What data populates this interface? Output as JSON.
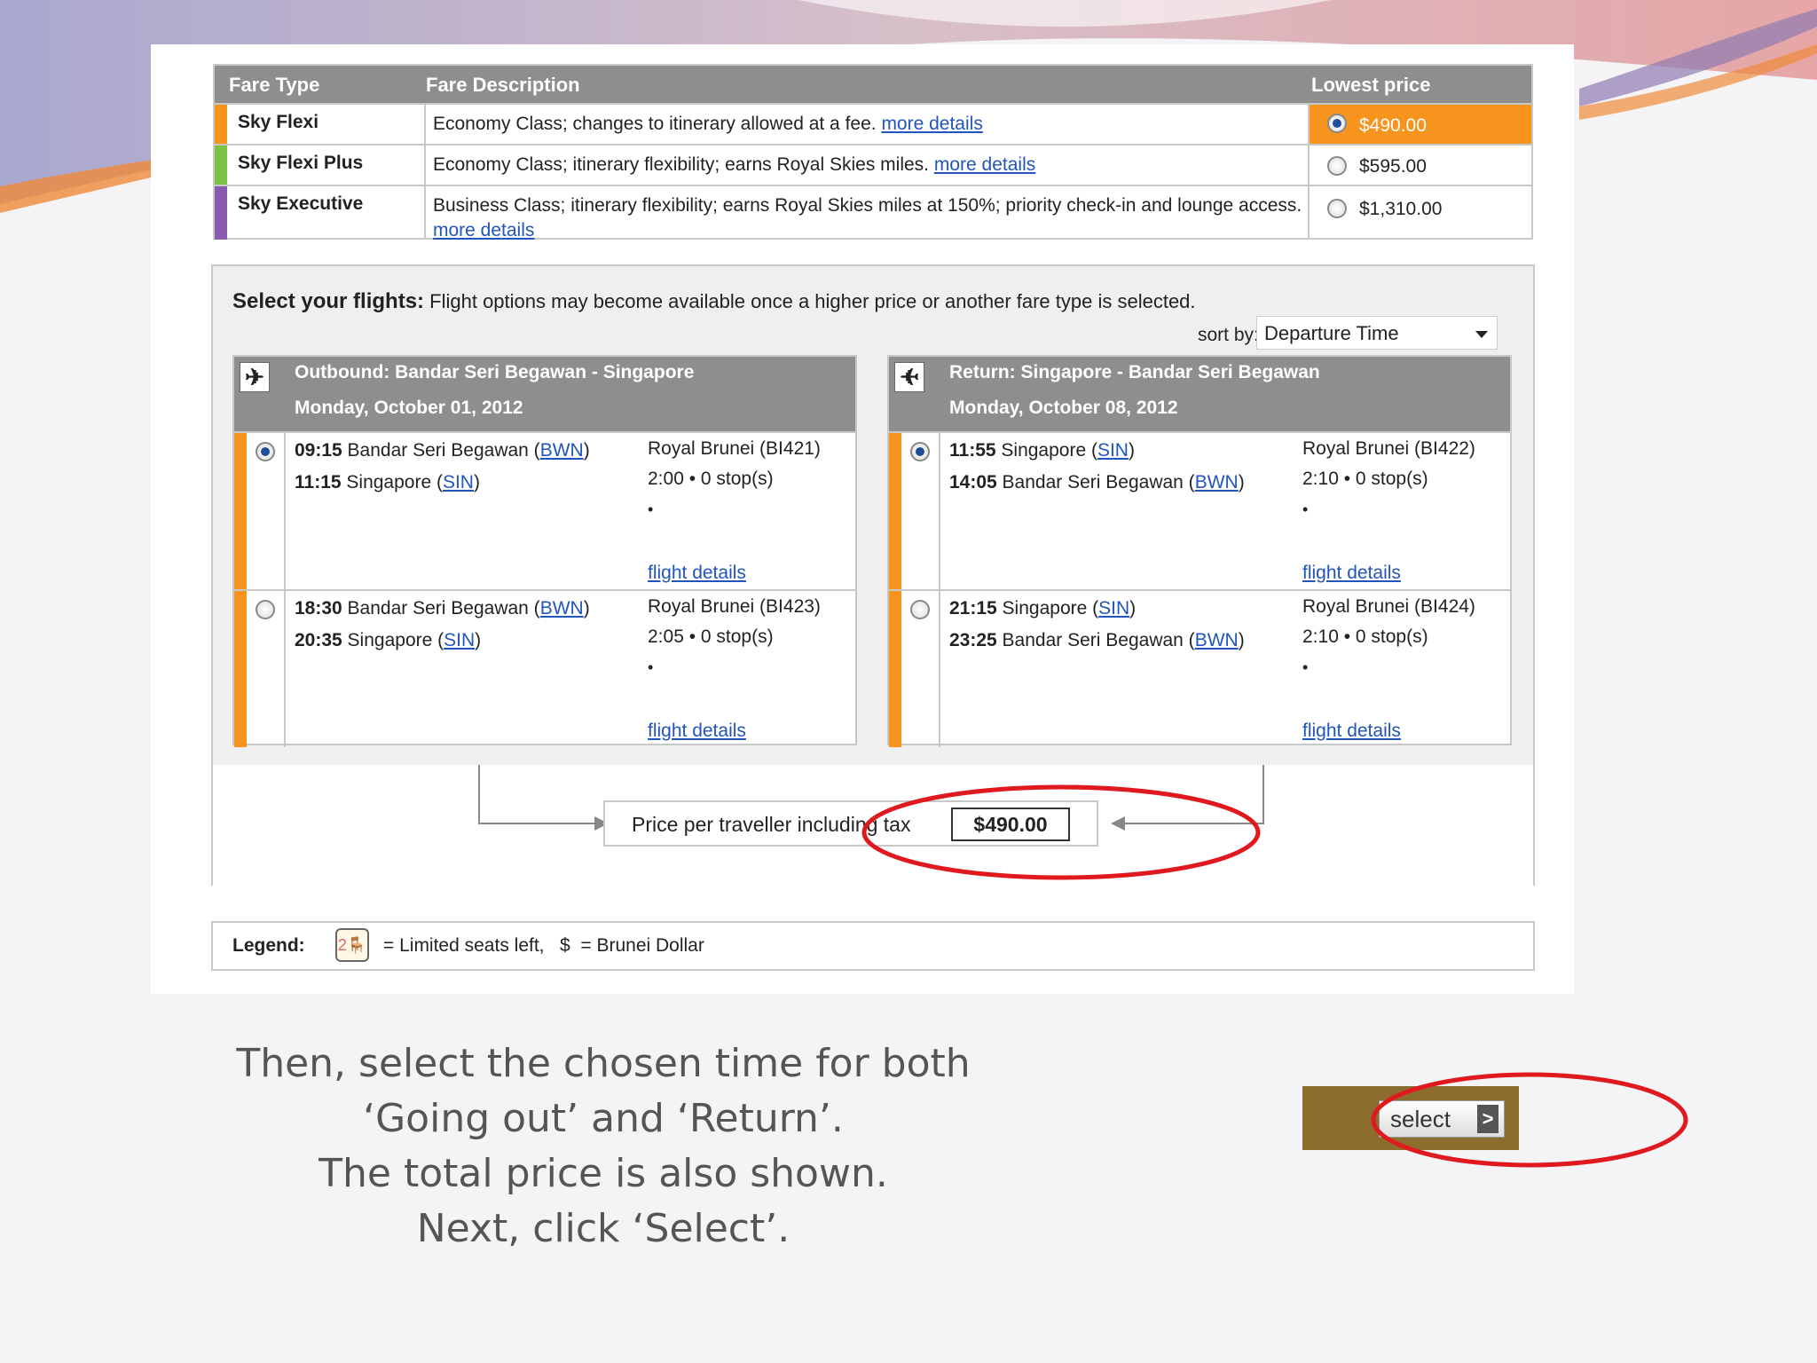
{
  "colors": {
    "fare_flexi": "#f7941d",
    "fare_flexi_plus": "#7cc242",
    "fare_executive": "#8a5ab0",
    "header_gray": "#8e8e8e",
    "link_blue": "#2255bb",
    "highlight_red": "#e0191f",
    "select_bar": "#8c6d2e"
  },
  "fare_table": {
    "headers": [
      "Fare Type",
      "Fare Description",
      "Lowest price"
    ],
    "rows": [
      {
        "type": "Sky Flexi",
        "desc": "Economy Class; changes to itinerary allowed at a fee.",
        "link": "more details",
        "price": "$490.00",
        "selected": true
      },
      {
        "type": "Sky Flexi Plus",
        "desc": "Economy Class; itinerary flexibility; earns Royal Skies miles.",
        "link": "more details",
        "price": "$595.00",
        "selected": false
      },
      {
        "type": "Sky Executive",
        "desc": "Business Class; itinerary flexibility; earns Royal Skies miles at 150%; priority check-in and lounge access.",
        "link": "more details",
        "price": "$1,310.00",
        "selected": false
      }
    ]
  },
  "flights": {
    "title_bold": "Select your flights:",
    "title_rest": " Flight options may become available once a higher price or another fare type is selected.",
    "sort_label": "sort by:",
    "sort_value": "Departure Time",
    "outbound": {
      "icon": "plane-depart-icon",
      "title": "Outbound: Bandar Seri Begawan - Singapore",
      "date": "Monday, October 01, 2012",
      "options": [
        {
          "dep_time": "09:15",
          "dep_city": " Bandar Seri Begawan (",
          "dep_code": "BWN",
          "arr_time": "11:15",
          "arr_city": " Singapore (",
          "arr_code": "SIN",
          "airline": "Royal Brunei (BI421)",
          "duration": "2:00",
          "stops": "0 stop(s)",
          "details": "flight details",
          "selected": true
        },
        {
          "dep_time": "18:30",
          "dep_city": " Bandar Seri Begawan (",
          "dep_code": "BWN",
          "arr_time": "20:35",
          "arr_city": " Singapore (",
          "arr_code": "SIN",
          "airline": "Royal Brunei (BI423)",
          "duration": "2:05",
          "stops": "0 stop(s)",
          "details": "flight details",
          "selected": false
        }
      ]
    },
    "return": {
      "icon": "plane-arrive-icon",
      "title": "Return: Singapore - Bandar Seri Begawan",
      "date": "Monday, October 08, 2012",
      "options": [
        {
          "dep_time": "11:55",
          "dep_city": " Singapore (",
          "dep_code": "SIN",
          "arr_time": "14:05",
          "arr_city": " Bandar Seri Begawan (",
          "arr_code": "BWN",
          "airline": "Royal Brunei (BI422)",
          "duration": "2:10",
          "stops": "0 stop(s)",
          "details": "flight details",
          "selected": true
        },
        {
          "dep_time": "21:15",
          "dep_city": " Singapore (",
          "dep_code": "SIN",
          "arr_time": "23:25",
          "arr_city": " Bandar Seri Begawan (",
          "arr_code": "BWN",
          "airline": "Royal Brunei (BI424)",
          "duration": "2:10",
          "stops": "0 stop(s)",
          "details": "flight details",
          "selected": false
        }
      ]
    },
    "price_label": "Price per traveller including tax",
    "price_value": "$490.00"
  },
  "legend": {
    "label": "Legend:",
    "seat_icon": "limited-seat-icon",
    "seat_num": "2",
    "text": "= Limited seats left,   $  = Brunei Dollar"
  },
  "caption": {
    "lines": [
      "Then, select the chosen time for both",
      "‘Going out’ and ‘Return’.",
      "The total price is also shown.",
      "Next, click ‘Select’."
    ]
  },
  "select_button": {
    "label": "select",
    "arrow": ">"
  }
}
